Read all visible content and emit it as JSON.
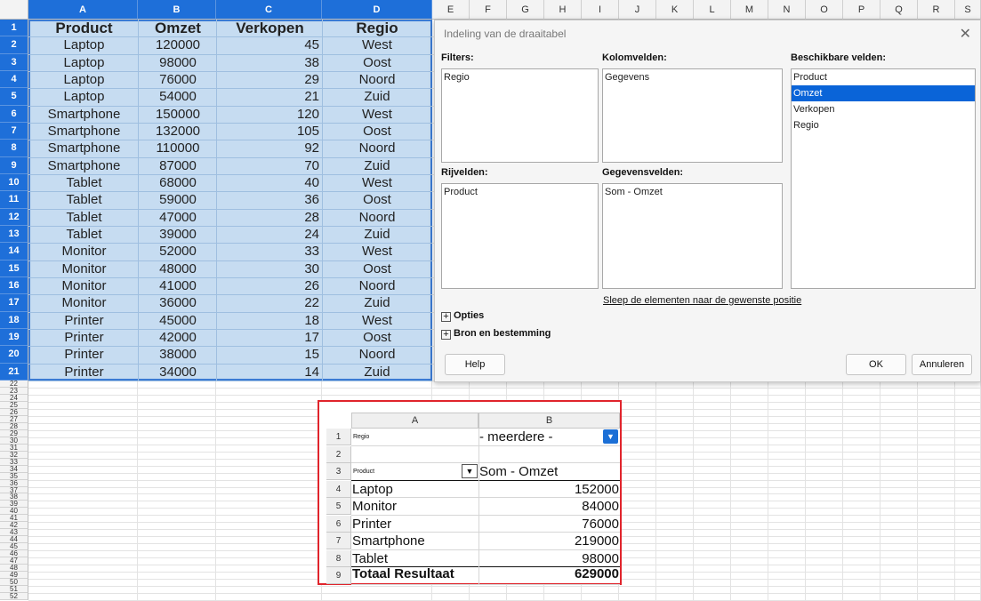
{
  "columns": [
    "A",
    "B",
    "C",
    "D",
    "E",
    "F",
    "G",
    "H",
    "I",
    "J",
    "K",
    "L",
    "M",
    "N",
    "O",
    "P",
    "Q",
    "R",
    "S"
  ],
  "rows_small": [
    "22",
    "23",
    "24",
    "25",
    "26",
    "27",
    "28",
    "29",
    "30",
    "31",
    "32",
    "33",
    "34",
    "35",
    "36",
    "37",
    "38",
    "39",
    "40",
    "41",
    "42",
    "43",
    "44",
    "45",
    "46",
    "47",
    "48",
    "49",
    "50",
    "51",
    "52"
  ],
  "table": {
    "headers": [
      "Product",
      "Omzet",
      "Verkopen",
      "Regio"
    ],
    "rows": [
      [
        "Laptop",
        "120000",
        "45",
        "West"
      ],
      [
        "Laptop",
        "98000",
        "38",
        "Oost"
      ],
      [
        "Laptop",
        "76000",
        "29",
        "Noord"
      ],
      [
        "Laptop",
        "54000",
        "21",
        "Zuid"
      ],
      [
        "Smartphone",
        "150000",
        "120",
        "West"
      ],
      [
        "Smartphone",
        "132000",
        "105",
        "Oost"
      ],
      [
        "Smartphone",
        "110000",
        "92",
        "Noord"
      ],
      [
        "Smartphone",
        "87000",
        "70",
        "Zuid"
      ],
      [
        "Tablet",
        "68000",
        "40",
        "West"
      ],
      [
        "Tablet",
        "59000",
        "36",
        "Oost"
      ],
      [
        "Tablet",
        "47000",
        "28",
        "Noord"
      ],
      [
        "Tablet",
        "39000",
        "24",
        "Zuid"
      ],
      [
        "Monitor",
        "52000",
        "33",
        "West"
      ],
      [
        "Monitor",
        "48000",
        "30",
        "Oost"
      ],
      [
        "Monitor",
        "41000",
        "26",
        "Noord"
      ],
      [
        "Monitor",
        "36000",
        "22",
        "Zuid"
      ],
      [
        "Printer",
        "45000",
        "18",
        "West"
      ],
      [
        "Printer",
        "42000",
        "17",
        "Oost"
      ],
      [
        "Printer",
        "38000",
        "15",
        "Noord"
      ],
      [
        "Printer",
        "34000",
        "14",
        "Zuid"
      ]
    ]
  },
  "dialog": {
    "title": "Indeling van de draaitabel",
    "close": "✕",
    "filters_label": "Filters:",
    "filters": [
      "Regio"
    ],
    "column_fields_label": "Kolomvelden:",
    "column_fields": [
      "Gegevens"
    ],
    "row_fields_label": "Rijvelden:",
    "row_fields": [
      "Product"
    ],
    "data_fields_label": "Gegevensvelden:",
    "data_fields": [
      "Som - Omzet"
    ],
    "available_label": "Beschikbare velden:",
    "available": [
      "Product",
      "Omzet",
      "Verkopen",
      "Regio"
    ],
    "available_selected": "Omzet",
    "hint": "Sleep de elementen naar de gewenste positie",
    "options_label": "Opties",
    "source_label": "Bron en bestemming",
    "help_button": "Help",
    "ok_button": "OK",
    "cancel_button": "Annuleren"
  },
  "pivot": {
    "col_a": "A",
    "col_b": "B",
    "row_nums": [
      "1",
      "2",
      "3",
      "4",
      "5",
      "6",
      "7",
      "8",
      "9"
    ],
    "filter_label": "Regio",
    "filter_value": "- meerdere -",
    "row_field": "Product",
    "data_field": "Som - Omzet",
    "items": [
      [
        "Laptop",
        "152000"
      ],
      [
        "Monitor",
        "84000"
      ],
      [
        "Printer",
        "76000"
      ],
      [
        "Smartphone",
        "219000"
      ],
      [
        "Tablet",
        "98000"
      ]
    ],
    "total_label": "Totaal Resultaat",
    "total_value": "629000"
  },
  "colors": {
    "selection": "#c6dcf1",
    "accent": "#1e6fd9",
    "highlight_border": "#e0242c"
  }
}
